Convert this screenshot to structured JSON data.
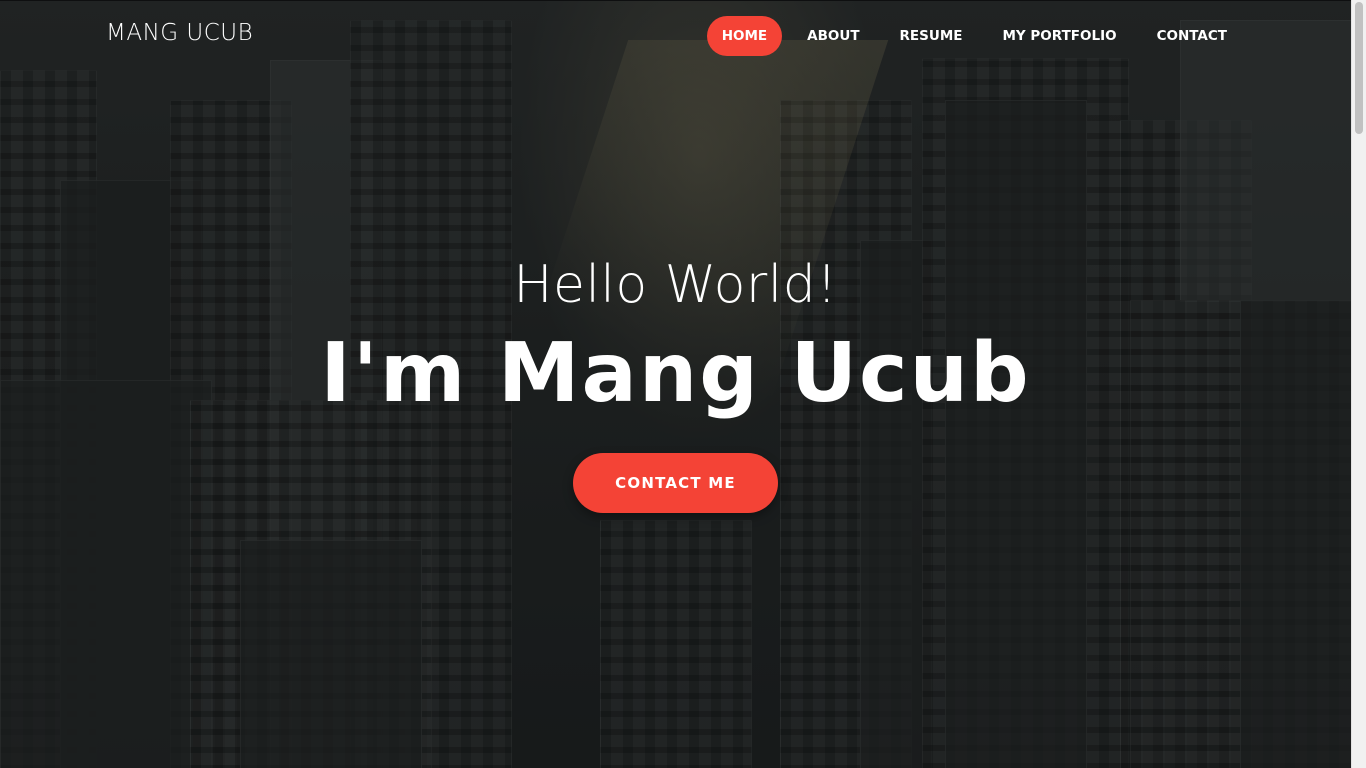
{
  "brand": "MANG UCUB",
  "nav": {
    "items": [
      {
        "label": "HOME",
        "active": true
      },
      {
        "label": "ABOUT",
        "active": false
      },
      {
        "label": "RESUME",
        "active": false
      },
      {
        "label": "MY PORTFOLIO",
        "active": false
      },
      {
        "label": "CONTACT",
        "active": false
      }
    ]
  },
  "hero": {
    "greeting": "Hello World!",
    "name": "I'm Mang Ucub",
    "cta_label": "CONTACT ME"
  },
  "colors": {
    "accent": "#f44336",
    "text": "#ffffff",
    "background": "#232626"
  }
}
